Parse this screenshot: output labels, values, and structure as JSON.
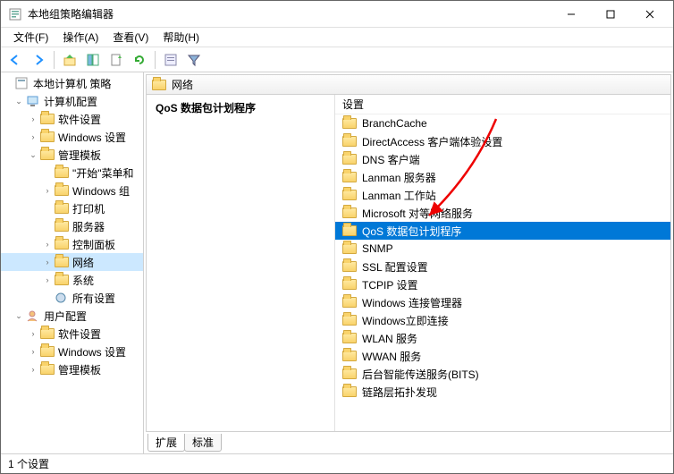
{
  "title": "本地组策略编辑器",
  "menu": {
    "file": "文件(F)",
    "action": "操作(A)",
    "view": "查看(V)",
    "help": "帮助(H)"
  },
  "tree": {
    "root": "本地计算机 策略",
    "computer": "计算机配置",
    "computer_children": {
      "software": "软件设置",
      "windows": "Windows 设置",
      "admin": "管理模板",
      "admin_children": {
        "start": "\"开始\"菜单和",
        "win_comp": "Windows 组",
        "printer": "打印机",
        "server": "服务器",
        "control": "控制面板",
        "network": "网络",
        "system": "系统",
        "all": "所有设置"
      }
    },
    "user": "用户配置",
    "user_children": {
      "software": "软件设置",
      "windows": "Windows 设置",
      "admin": "管理模板"
    }
  },
  "content": {
    "header": "网络",
    "selection_title": "QoS 数据包计划程序",
    "settings_label": "设置",
    "items": [
      "BranchCache",
      "DirectAccess 客户端体验设置",
      "DNS 客户端",
      "Lanman 服务器",
      "Lanman 工作站",
      "Microsoft 对等网络服务",
      "QoS 数据包计划程序",
      "SNMP",
      "SSL 配置设置",
      "TCPIP 设置",
      "Windows 连接管理器",
      "Windows立即连接",
      "WLAN 服务",
      "WWAN 服务",
      "后台智能传送服务(BITS)",
      "链路层拓扑发现"
    ],
    "selected_index": 6
  },
  "tabs": {
    "extended": "扩展",
    "standard": "标准"
  },
  "status": "1 个设置"
}
